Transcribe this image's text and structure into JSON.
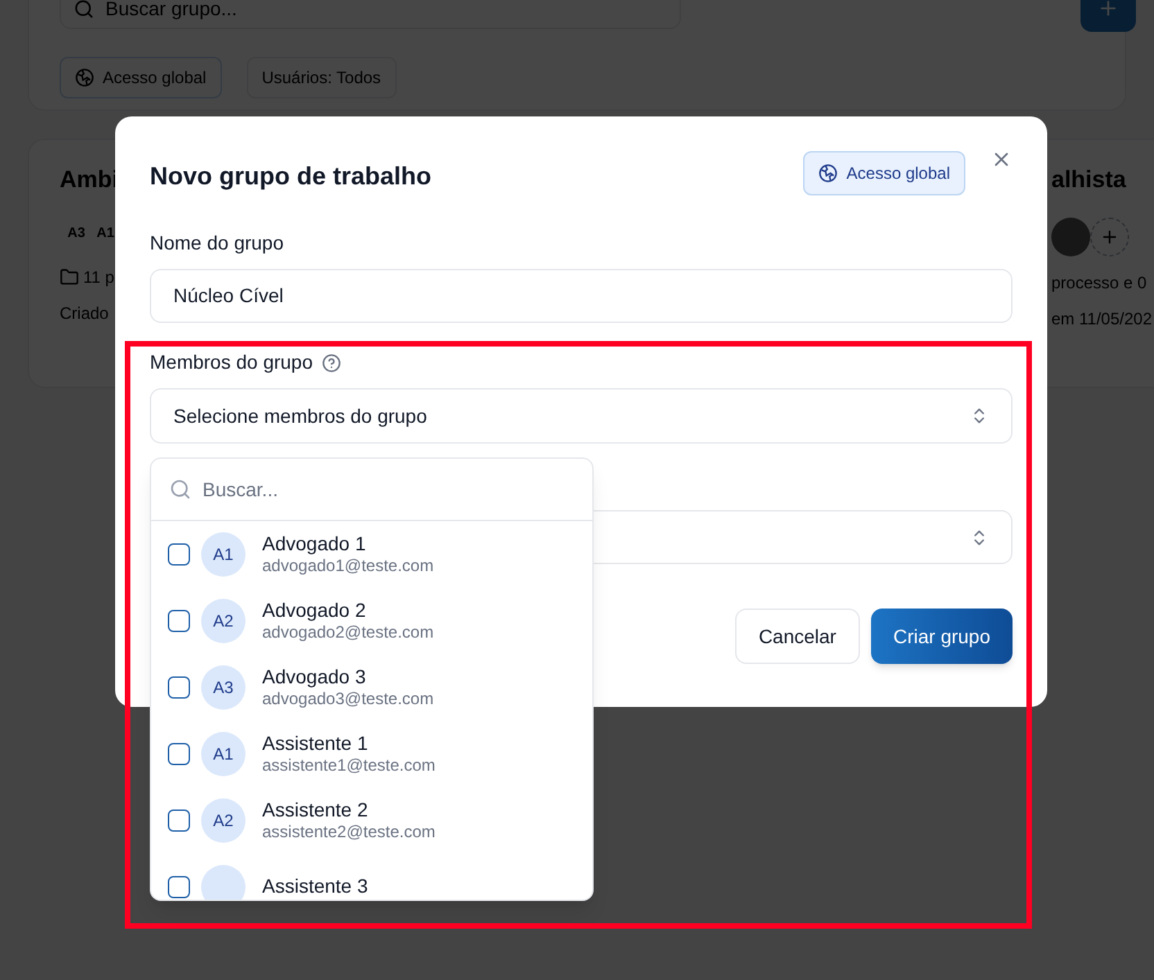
{
  "background": {
    "search": {
      "placeholder": "Buscar grupo..."
    },
    "filters": [
      {
        "label": "Acesso global",
        "kind": "scope"
      },
      {
        "label": "Usuários: Todos",
        "kind": "plain"
      }
    ],
    "cards": [
      {
        "title": "Ambi",
        "avatars": [
          {
            "kind": "initials",
            "text": "A3"
          },
          {
            "kind": "initials",
            "text": "A1"
          }
        ],
        "meta": "11 p",
        "created": "Criado"
      },
      {
        "title": "alhista",
        "avatars": [
          {
            "kind": "photo"
          },
          {
            "kind": "add"
          }
        ],
        "meta": "processo e 0",
        "created": "em 11/05/202"
      }
    ]
  },
  "dialog": {
    "title": "Novo grupo de trabalho",
    "badge": "Acesso global",
    "name_field": {
      "label": "Nome do grupo",
      "value": "Núcleo Cível"
    },
    "members_field": {
      "label": "Membros do grupo",
      "value": "Selecione membros do grupo"
    },
    "dropdown": {
      "search": {
        "placeholder": "Buscar..."
      },
      "options": [
        {
          "name": "Advogado 1",
          "email": "advogado1@teste.com",
          "initials": "A1",
          "checked": false
        },
        {
          "name": "Advogado 2",
          "email": "advogado2@teste.com",
          "initials": "A2",
          "checked": false
        },
        {
          "name": "Advogado 3",
          "email": "advogado3@teste.com",
          "initials": "A3",
          "checked": false
        },
        {
          "name": "Assistente 1",
          "email": "assistente1@teste.com",
          "initials": "A1",
          "checked": false
        },
        {
          "name": "Assistente 2",
          "email": "assistente2@teste.com",
          "initials": "A2",
          "checked": false
        },
        {
          "name": "Assistente 3",
          "checked": false
        }
      ]
    },
    "buttons": [
      {
        "label": "Cancelar",
        "kind": "secondary"
      },
      {
        "label": "Criar grupo",
        "kind": "primary"
      }
    ]
  }
}
